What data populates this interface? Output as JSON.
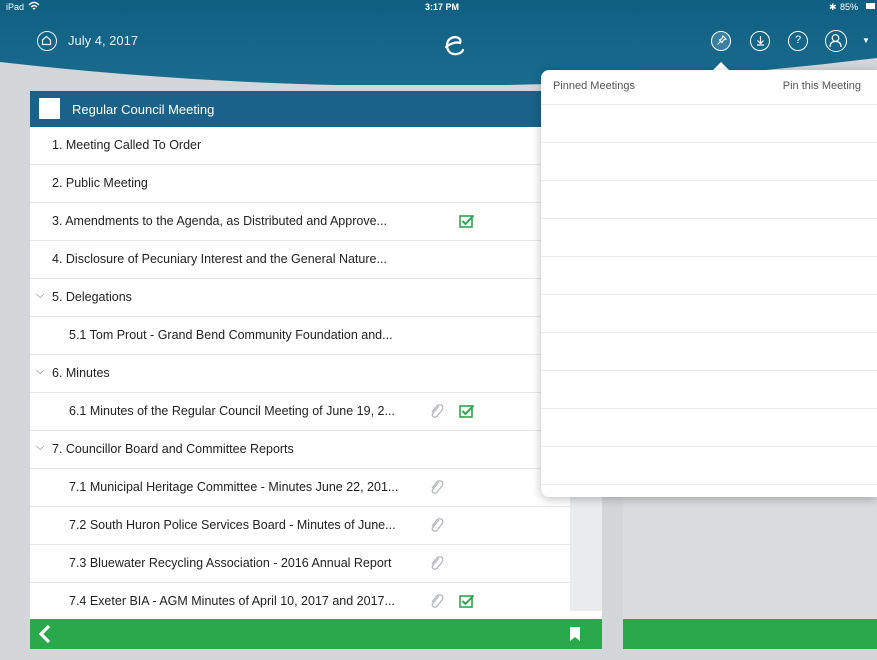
{
  "status_bar": {
    "device": "iPad",
    "time": "3:17 PM",
    "battery": "85%"
  },
  "header": {
    "date": "July 4, 2017",
    "icons": [
      "home-icon",
      "logo-icon",
      "pin-icon",
      "download-icon",
      "help-icon",
      "user-icon"
    ]
  },
  "agenda": {
    "title": "Regular Council Meeting",
    "items": [
      {
        "label": "1. Meeting Called To Order",
        "expandable": false
      },
      {
        "label": "2. Public Meeting",
        "expandable": false
      },
      {
        "label": "3. Amendments to the Agenda, as Distributed and Approve...",
        "check": true
      },
      {
        "label": "4. Disclosure of Pecuniary Interest and the General Nature..."
      },
      {
        "label": "5. Delegations",
        "expandable": true
      },
      {
        "label": "5.1 Tom Prout - Grand Bend Community Foundation and..."
      },
      {
        "label": "6. Minutes",
        "expandable": true
      },
      {
        "label": "6.1 Minutes of the Regular Council Meeting of June 19, 2...",
        "attachment": true,
        "check": true
      },
      {
        "label": "7. Councillor Board and Committee Reports",
        "expandable": true
      },
      {
        "label": "7.1 Municipal Heritage Committee - Minutes June 22, 201...",
        "attachment": true
      },
      {
        "label": "7.2 South Huron Police Services Board - Minutes of June...",
        "attachment": true
      },
      {
        "label": "7.3 Bluewater Recycling Association - 2016 Annual Report",
        "attachment": true
      },
      {
        "label": "7.4 Exeter BIA - AGM Minutes of April 10, 2017 and  2017...",
        "attachment": true,
        "check": true
      }
    ]
  },
  "popover": {
    "tab_left": "Pinned Meetings",
    "tab_right": "Pin this Meeting"
  },
  "colors": {
    "header": "#1a6c8f",
    "agenda_header": "#1a6289",
    "footer": "#29a84c",
    "check": "#2ea44f"
  }
}
